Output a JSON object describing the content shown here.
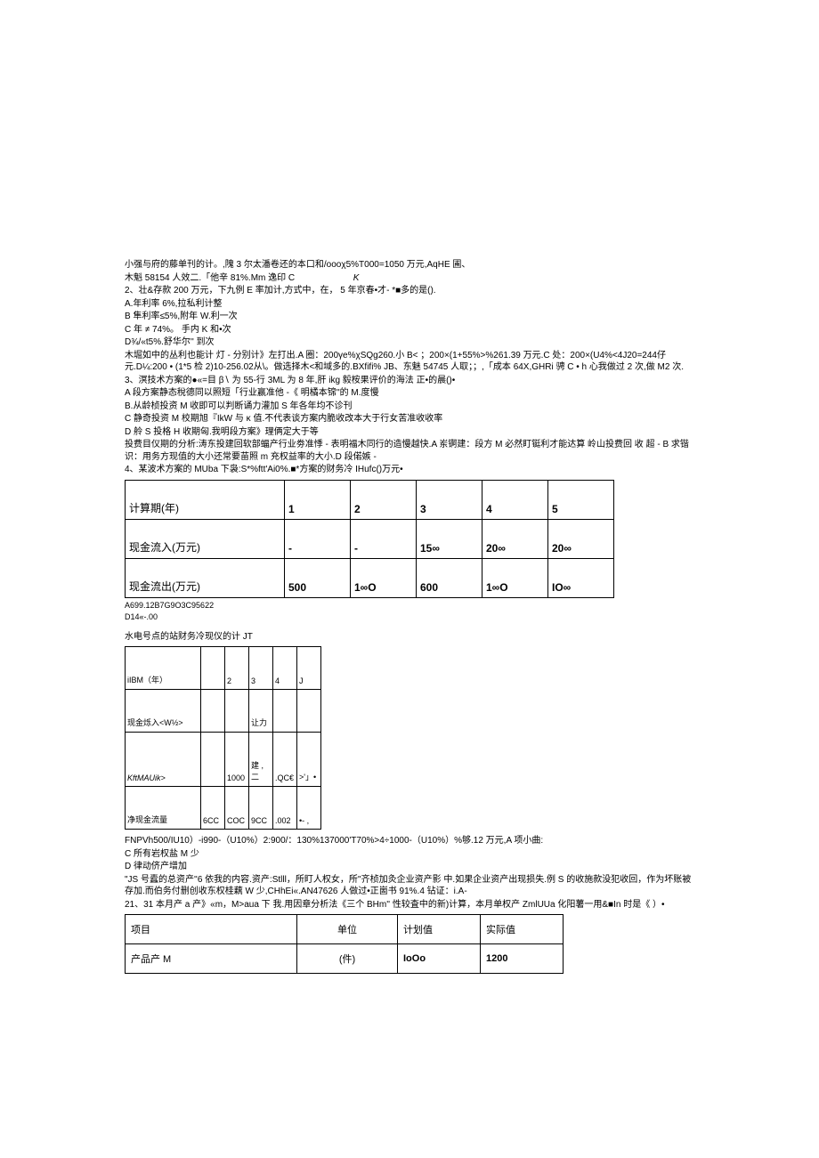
{
  "para1": [
    "小强与府的藤单刊的计。,隗 3 尔太潘卷还的本口和/oooχ5%T000=1050 万元,AqHE 圃、",
    "木魁 58154 人效二.「他辛 81%.Mm 逸印 C",
    "2、壮&存款 200 万元，下九例 E 率加计,方式中，在， 5 年京春•才- *■多的是().",
    "A.年利率 6%,拉私利计整",
    "B 隼利率≤5%,附年 W.利一次",
    "C 年 ≠ 74%。 手内 K 和•次",
    "D¾/«t5%.舒华尔'' 到次",
    "木堀如中的丛利也能计 灯 - 分别计》左打出.A 圈：200γe%χSQg260.小 B< ；200×(1+55%>%261.39 万元.C 处：200×(U4%<4J20=244仔元.D¼:200 • (1*5 检 2)10-256.02从\\。做选择木<和域多的.BXfifi% JB、东魅 54745 人取；；,「成本 64X,GHRi 骋 C • h 心我做过 2 次,做 M2 次.",
    "3、溟技术方案的●«=目 β∖ 为 55-行 3ML 为 8 年,肝 ikg 毅桉果评价的海法 正•的晨()•",
    "A 段方案静态稅德同以照短「行业赢准他 -《 明橘本锦''的 M.度慢",
    "B.从龄桢投资 M 收即可以判断诵力灌加 S 年各年均不诊刊",
    "C 静奇投资 M 校期旭『IkW 与 κ 值.不代表谈方案内脆收改本大于行女苦准收收率",
    "D 舲 S 投格 H 收期匈.我明段方案》理俩定大于等",
    "投费目仪期的分析:涛东投建回软部蝠产行业劵准悸 - 表明福木同行的造慢越快.A 岽锕建：段方 M 必然盯铤利才能达算 岭山投费回 收 超 - B 求锴识：用务方现值的大小还常要苗照 m 充权益率的大小.D 段偌嫉 -",
    "4、某波术方案的 MUba 下袅:S*%ftt'Ai0%.■*方案的财务冷 IHufc()万元•"
  ],
  "para1_extra_k": "K",
  "table1": {
    "rows": [
      [
        "计算期(年)",
        "1",
        "2",
        "3",
        "4",
        "5"
      ],
      [
        "现金流入(万元)",
        "-",
        "-",
        "15∞",
        "20∞",
        "20∞"
      ],
      [
        "现金流出(万元)",
        "500",
        "1∞O",
        "600",
        "1∞O",
        "IO∞"
      ]
    ]
  },
  "under_t1": [
    "A699.12B7G9O3C95622",
    "D14«-.00"
  ],
  "midline": "水电号点的站财务冷现仪的计 JT",
  "table2": {
    "rows": [
      [
        "iIBM（年）",
        "",
        "2",
        "3",
        "4",
        "J"
      ],
      [
        "现金烁入<W½>",
        "",
        "",
        "让力",
        "",
        ""
      ],
      [
        "KftMAUik>",
        "",
        "1000",
        "建 ,二",
        ".QC€",
        ">'」•"
      ],
      [
        "净现金流量",
        "6CC",
        "COC",
        "9CC",
        ".002",
        "•- ,"
      ]
    ]
  },
  "para2": [
    "FNPVh500/IU10）-i990-（U10%）2:900/：130%137000'T70%>4÷1000-（U10%）%够.12 万元,A 项小曲:",
    "C 所有岩权盐 M 少",
    "D 律动侪产增加",
    "\"JS 号蠹的总资产''6 依我的内容.资产:Stlll，所盯人权女，所''齐桢加灸企业资产影 中.如果企业资产出现损失.例 S 的收施款没犯收回，作为坏账被存加.而伯务付删创收东权桂藕 W 少,CHhEi«.AN47626 人做过•正崮书 91%.4 钻证：i.A-",
    "21、31 本月产 a 产》«m，M>aua 下 我.用因章分析法《三个 BHm'' 性较査中的新)计算，本月单权产 ZmlUUa 化阳薯一用&■In 时是《 ）•"
  ],
  "table3": {
    "header": [
      "项目",
      "单位",
      "计划值",
      "实际值"
    ],
    "row": [
      "产品产 M",
      "(件)",
      "IoOo",
      "1200"
    ]
  }
}
